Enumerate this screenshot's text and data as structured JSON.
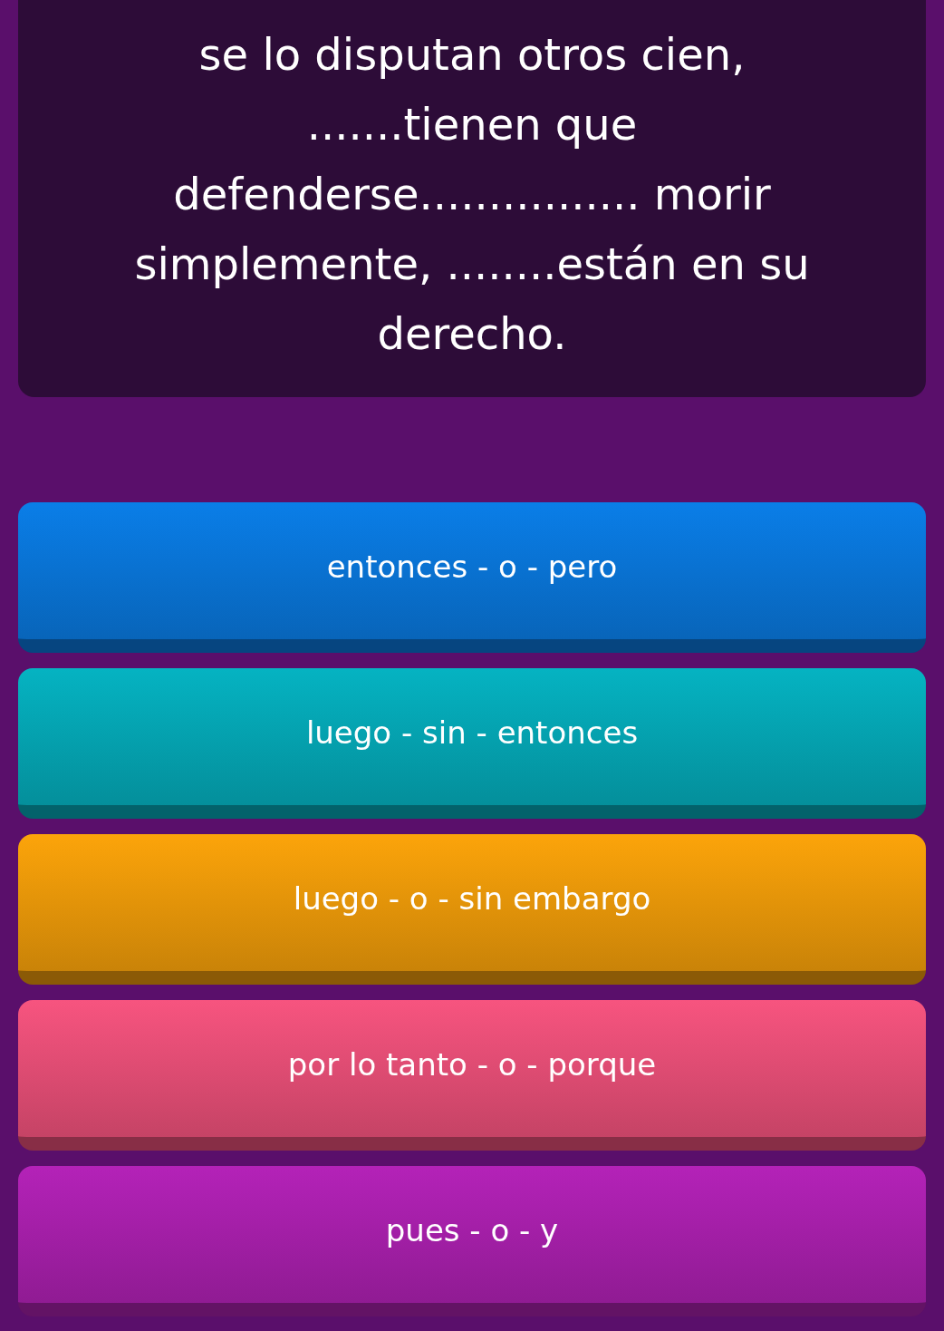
{
  "question": {
    "text": "se lo disputan otros cien,\n.......tienen que\ndefenderse................ morir\nsimplemente, ........están en su\nderecho."
  },
  "answers": [
    {
      "label": "entonces - o - pero",
      "color": "#0a7ee8"
    },
    {
      "label": "luego - sin - entonces",
      "color": "#05b3c2"
    },
    {
      "label": "luego - o - sin embargo",
      "color": "#fca40a"
    },
    {
      "label": "por lo tanto - o - porque",
      "color": "#f7547f"
    },
    {
      "label": "pues - o - y",
      "color": "#b422b8"
    }
  ]
}
